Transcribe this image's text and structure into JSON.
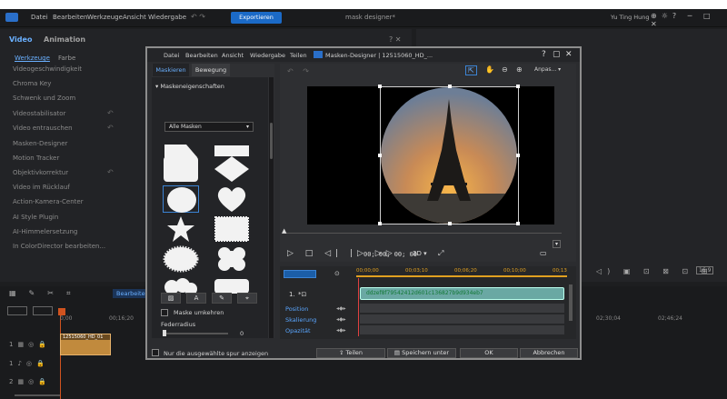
{
  "app": {
    "menu": [
      "Datei",
      "Bearbeiten",
      "Werkzeuge",
      "Ansicht",
      "Wiedergabe"
    ],
    "export_label": "Exportieren",
    "project_title": "mask designer*",
    "user_name": "Yu Ting Hung"
  },
  "left_panel": {
    "tabs": [
      "Video",
      "Animation"
    ],
    "subtabs": [
      "Werkzeuge",
      "Farbe"
    ],
    "tools": [
      "Videogeschwindigkeit",
      "Chroma Key",
      "Schwenk und Zoom",
      "Videostabilisator",
      "Video entrauschen",
      "Masken-Designer",
      "Motion Tracker",
      "Objektivkorrektur",
      "Video im Rücklauf",
      "Action-Kamera-Center",
      "AI Style Plugin",
      "AI-Himmelersetzung",
      "In ColorDirector bearbeiten..."
    ]
  },
  "timeline": {
    "edit_label": "Bearbeiten",
    "ruler": [
      "0;00",
      "00;16;20",
      "02;30;04",
      "02;46;24"
    ],
    "clip_label": "12515060_HD_01"
  },
  "dialog": {
    "menu": [
      "Datei",
      "Bearbeiten",
      "Ansicht",
      "Wiedergabe",
      "Teilen"
    ],
    "title": "Masken-Designer | 12515060_HD_...",
    "sidebar_tabs": [
      "Maskieren",
      "Bewegung"
    ],
    "section_title": "Maskeneigenschaften",
    "mask_filter": "Alle Masken",
    "invert_label": "Maske umkehren",
    "feather_label": "Federradius",
    "feather_value": "0",
    "only_selected_label": "Nur die ausgewählte spur anzeigen",
    "zoom_label": "Anpas...",
    "timecode": "00; 00; 00; 00",
    "mode_3d": "3D",
    "ruler": [
      "00;00;00",
      "00;03;10",
      "00;06;20",
      "00;10;00",
      "00;13"
    ],
    "track_index": "1.",
    "clip_id": "ddzef8f79542412d601c136827b9d934eb7",
    "attributes": [
      "Position",
      "Skalierung",
      "Opazität"
    ],
    "buttons": {
      "share": "Teilen",
      "save_as": "Speichern unter",
      "ok": "OK",
      "cancel": "Abbrechen"
    }
  }
}
